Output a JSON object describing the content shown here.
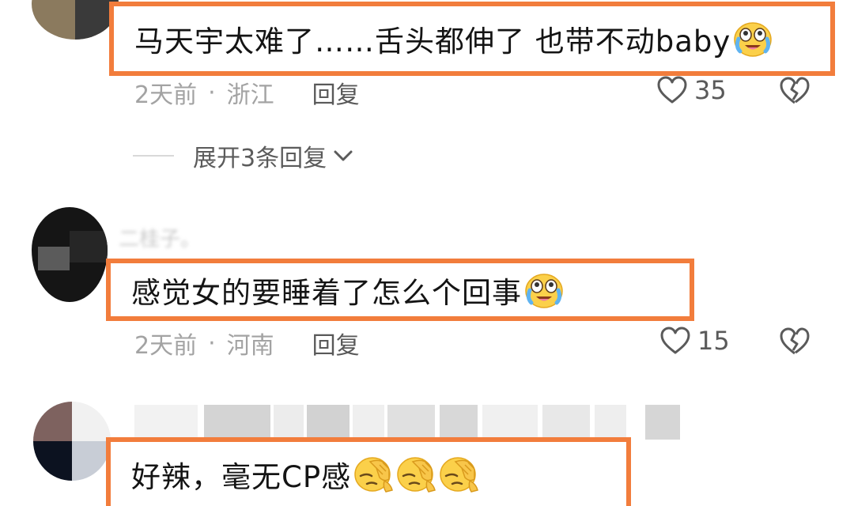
{
  "comments": [
    {
      "text": "马天宇太难了……舌头都伸了 也带不动baby",
      "emojis": [
        "crying-laugh-emoji"
      ],
      "time": "2天前",
      "separator": "·",
      "location": "浙江",
      "reply_label": "回复",
      "likes": "35",
      "expand_label": "展开3条回复"
    },
    {
      "username": "二桂子。",
      "text": "感觉女的要睡着了怎么个回事",
      "emojis": [
        "crying-laugh-emoji"
      ],
      "time": "2天前",
      "separator": "·",
      "location": "河南",
      "reply_label": "回复",
      "likes": "15"
    },
    {
      "text": "好辣，毫无CP感",
      "emojis": [
        "facepalm-emoji",
        "facepalm-emoji",
        "facepalm-emoji"
      ]
    }
  ],
  "colors": {
    "highlight_border": "#f27d3c",
    "meta_text": "#a3a3a3",
    "action_text": "#5a5a5a"
  },
  "icons": {
    "like": "heart-outline-icon",
    "dislike": "broken-heart-outline-icon",
    "expand": "chevron-down-icon"
  }
}
